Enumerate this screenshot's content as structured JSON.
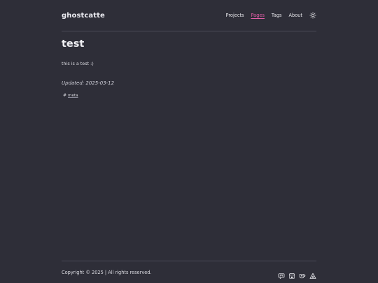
{
  "header": {
    "brand": "ghostcatte",
    "nav": [
      {
        "label": "Projects"
      },
      {
        "label": "Pages"
      },
      {
        "label": "Tags"
      },
      {
        "label": "About"
      }
    ],
    "active_nav": "Pages",
    "theme_icon": "sun-icon"
  },
  "post": {
    "title": "test",
    "body": "this is a test :)",
    "updated": "Updated: 2025-03-12",
    "tag_hash": "#",
    "tag": "meta"
  },
  "footer": {
    "copyright": "Copyright © 2025 | All rights reserved.",
    "social_icons": [
      "mastodon-icon",
      "shop-icon",
      "kofi-icon",
      "triangle-icon"
    ]
  },
  "colors": {
    "background": "#2e2e38",
    "accent": "#e25ea8",
    "rule": "#4a4a58"
  }
}
